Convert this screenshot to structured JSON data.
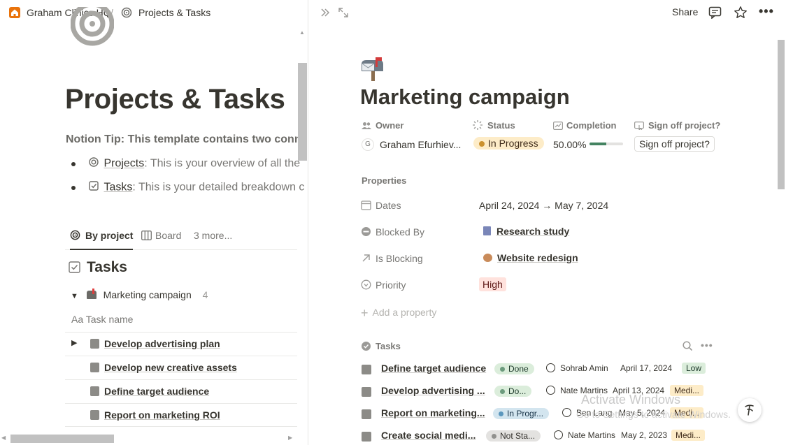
{
  "breadcrumb": {
    "workspace": "Graham Clinics HQ",
    "separator": "/",
    "page": "Projects & Tasks"
  },
  "left": {
    "title": "Projects & Tasks",
    "tip": "Notion Tip: This template contains two conne",
    "bullets": [
      {
        "link": "Projects",
        "text": ": This is your overview of all the"
      },
      {
        "link": "Tasks",
        "text": ": This is your detailed breakdown c"
      }
    ],
    "tabs": {
      "by_project": "By project",
      "board": "Board",
      "more": "3 more..."
    },
    "tasks_heading": "Tasks",
    "group": {
      "name": "Marketing campaign",
      "count": "4"
    },
    "column_header": "Task name",
    "column_prefix": "Aa",
    "rows": [
      "Develop advertising plan",
      "Develop new creative assets",
      "Define target audience",
      "Report on marketing ROI"
    ]
  },
  "right": {
    "topbar": {
      "share": "Share"
    },
    "title": "Marketing campaign",
    "props_header": {
      "owner": "Owner",
      "status": "Status",
      "completion": "Completion",
      "signoff": "Sign off project?"
    },
    "owner": {
      "initial": "G",
      "name": "Graham Efurhiev..."
    },
    "status": "In Progress",
    "completion": {
      "text": "50.00%",
      "value": 0.5
    },
    "signoff_button": "Sign off project?",
    "properties_label": "Properties",
    "properties": [
      {
        "label": "Dates",
        "value": "April 24, 2024 → May 7, 2024"
      },
      {
        "label": "Blocked By",
        "value": "Research study"
      },
      {
        "label": "Is Blocking",
        "value": "Website redesign"
      },
      {
        "label": "Priority",
        "value": "High"
      }
    ],
    "add_property": "Add a property",
    "tasks_label": "Tasks",
    "tasks": [
      {
        "name": "Define target audience",
        "status": "Done",
        "person": "Sohrab Amin",
        "date": "April 17, 2024",
        "priority": "Low"
      },
      {
        "name": "Develop advertising ...",
        "status": "Do...",
        "person": "Nate Martins",
        "date": "April 13, 2024",
        "priority": "Medi..."
      },
      {
        "name": "Report on marketing...",
        "status": "In Progr...",
        "person": "Ben Lang",
        "date": "May 5, 2024",
        "priority": "Medi..."
      },
      {
        "name": "Create social medi...",
        "status": "Not Sta...",
        "person": "Nate Martins",
        "date": "May 2, 2023",
        "priority": "Medi..."
      }
    ],
    "watermark": "Activate Windows",
    "watermark_sub": "Go to Settings to activate Windows."
  },
  "colors": {
    "accent_home": "#e9730c",
    "status_in_progress_bg": "#fdecc8",
    "status_done_bg": "#dbeddb",
    "status_blue_bg": "#d3e5ef",
    "status_gray_bg": "#e3e2e0",
    "priority_high_bg": "#ffe2dd",
    "priority_low_bg": "#dbeddb",
    "priority_med_bg": "#fdecc8",
    "progress_fill": "#448361"
  }
}
